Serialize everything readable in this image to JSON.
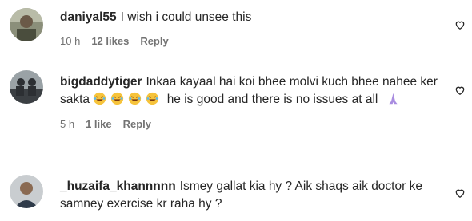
{
  "comments": [
    {
      "username": "daniyal55",
      "text": "I wish i could unsee this",
      "time": "10 h",
      "likes": "12 likes",
      "reply": "Reply",
      "avatar": "avatar-photo"
    },
    {
      "username": "bigdaddytiger",
      "text_part1": "Inkaa kayaal hai koi bhee molvi kuch bhee nahee ker sakta",
      "emojis": [
        "laughing-emoji",
        "laughing-emoji",
        "laughing-emoji",
        "laughing-emoji"
      ],
      "text_part2": "he is good and there is no issues at all",
      "trailing_emoji": "praying-hands-emoji",
      "time": "5 h",
      "likes": "1 like",
      "reply": "Reply",
      "avatar": "avatar-photo"
    },
    {
      "username": "_huzaifa_khannnnn",
      "text": "Ismey gallat kia hy ? Aik shaqs aik doctor ke samney exercise kr raha hy ?",
      "avatar": "avatar-photo"
    }
  ],
  "colors": {
    "text": "#262626",
    "meta": "#737373",
    "background": "#ffffff"
  },
  "icons": {
    "like": "heart-outline-icon"
  }
}
